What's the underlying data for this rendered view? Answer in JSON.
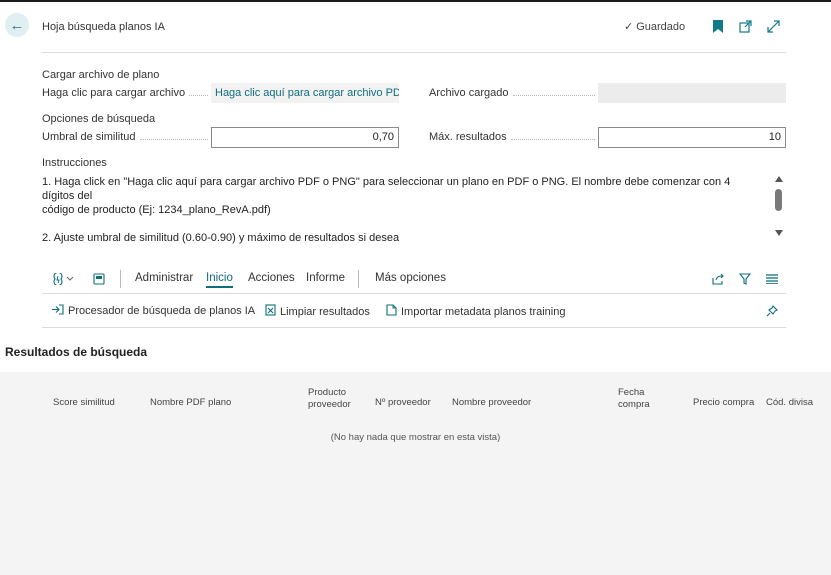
{
  "header": {
    "title": "Hoja búsqueda planos IA",
    "saved_label": "Guardado",
    "saved_check": "✓"
  },
  "upload": {
    "section_title": "Cargar archivo de plano",
    "click_label": "Haga clic para cargar archivo",
    "click_value": "Haga clic aquí para cargar archivo PD...",
    "loaded_label": "Archivo cargado",
    "loaded_value": ""
  },
  "search_options": {
    "section_title": "Opciones de búsqueda",
    "threshold_label": "Umbral de similitud",
    "threshold_value": "0,70",
    "max_results_label": "Máx. resultados",
    "max_results_value": "10"
  },
  "instructions": {
    "title": "Instrucciones",
    "line1": "1. Haga click en \"Haga clic aquí para cargar archivo PDF o PNG\" para seleccionar un plano en PDF o PNG. El nombre debe comenzar con 4 dígitos del",
    "line2": "código de producto (Ej: 1234_plano_RevA.pdf)",
    "line3": "2. Ajuste umbral de similitud (0.60-0.90) y máximo de resultados si desea"
  },
  "menu": {
    "items": [
      "Administrar",
      "Inicio",
      "Acciones",
      "Informe"
    ],
    "more": "Más opciones",
    "active": "Inicio"
  },
  "actions": {
    "a1": "Procesador de búsqueda de planos IA",
    "a2": "Limpiar resultados",
    "a3": "Importar metadata planos training"
  },
  "results": {
    "title": "Resultados de búsqueda",
    "columns": [
      "Score similitud",
      "Nombre PDF plano",
      "Producto proveedor",
      "Nº proveedor",
      "Nombre proveedor",
      "Fecha compra",
      "Precio compra",
      "Cód. divisa"
    ],
    "col3_l1": "Producto",
    "col3_l2": "proveedor",
    "col6_l1": "Fecha",
    "col6_l2": "compra",
    "empty_message": "(No hay nada que mostrar en esta vista)"
  },
  "colors": {
    "accent": "#0f6d7c",
    "table_bg": "#f4f4f4"
  }
}
